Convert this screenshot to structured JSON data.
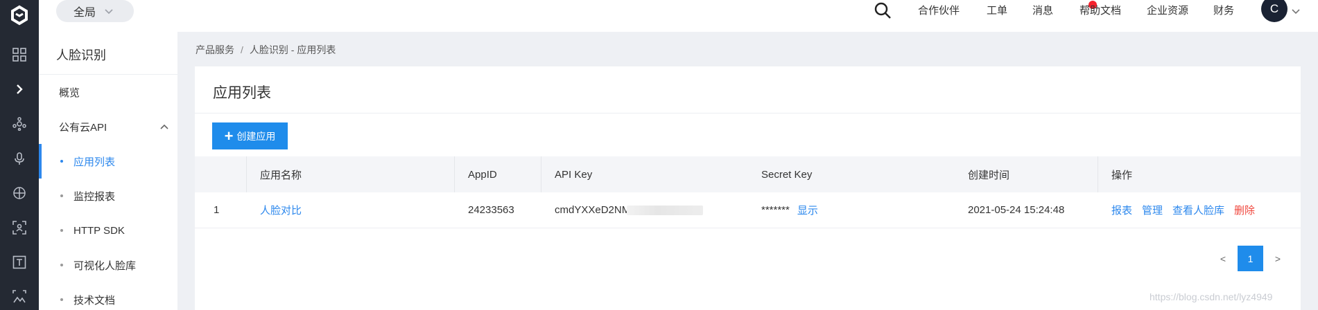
{
  "rail": {
    "icons": [
      "logo-icon",
      "grid-icon",
      "expand-icon",
      "network-icon",
      "microphone-icon",
      "globe-icon",
      "face-scan-icon",
      "text-icon",
      "image-icon"
    ]
  },
  "header": {
    "scope_label": "全局",
    "nav": [
      "合作伙伴",
      "工单",
      "消息",
      "帮助文档",
      "企业资源",
      "财务"
    ],
    "avatar_initial": "C",
    "message_dot_color": "#f5222d"
  },
  "sidebar": {
    "title": "人脸识别",
    "items": [
      {
        "label": "概览"
      },
      {
        "label": "公有云API"
      },
      {
        "label": "应用列表"
      },
      {
        "label": "监控报表"
      },
      {
        "label": "HTTP SDK"
      },
      {
        "label": "可视化人脸库"
      },
      {
        "label": "技术文档"
      }
    ]
  },
  "breadcrumb": {
    "root": "产品服务",
    "separator": "/",
    "current": "人脸识别 - 应用列表"
  },
  "main": {
    "title": "应用列表",
    "create_button": "创建应用",
    "accent_color": "#1f8ceb",
    "table": {
      "columns": [
        "",
        "应用名称",
        "AppID",
        "API Key",
        "Secret Key",
        "创建时间",
        "操作"
      ],
      "rows": [
        {
          "index": "1",
          "name": "人脸对比",
          "app_id": "24233563",
          "api_key": "cmdYXXeD2NMe",
          "secret_key": "*******",
          "secret_show": "显示",
          "created": "2021-05-24 15:24:48",
          "actions": [
            "报表",
            "管理",
            "查看人脸库",
            "删除"
          ]
        }
      ]
    },
    "pagination": {
      "prev": "<",
      "current": "1",
      "next": ">"
    }
  },
  "watermark": "https://blog.csdn.net/lyz4949"
}
